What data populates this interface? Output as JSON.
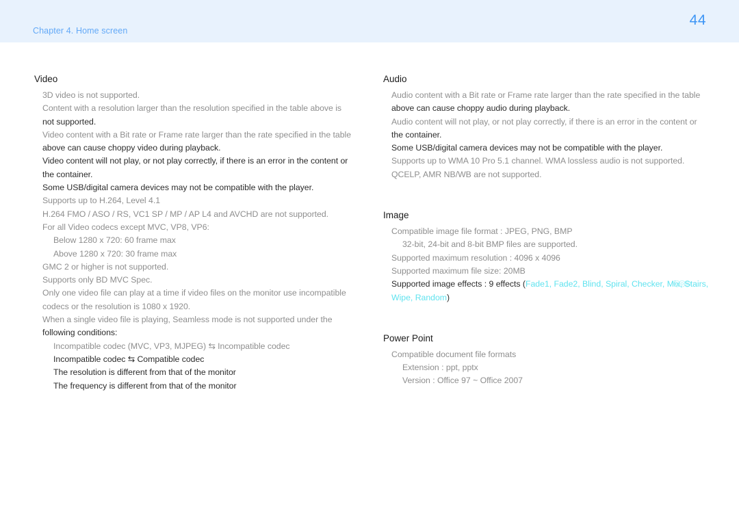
{
  "header": {
    "chapter_label": "Chapter 4. Home screen",
    "page_number": "44",
    "band_color": "#e8f2fd",
    "link_color": "#63a9f7"
  },
  "colors": {
    "accent_cyan": "#62e3ef",
    "body_gray": "#8e8e8e",
    "body_dark": "#2b2b2b"
  },
  "left_column": {
    "sections": [
      {
        "title": "Video",
        "lines": [
          {
            "text": "3D video is not supported.",
            "tone": "gray",
            "indent": 0
          },
          {
            "text": "Content with a resolution larger than the resolution specified in the table above is",
            "tone": "gray",
            "indent": 0
          },
          {
            "text": "not supported.",
            "tone": "dark",
            "indent": 0
          },
          {
            "text": "Video content with a Bit rate or Frame rate larger than the rate specified in the table",
            "tone": "gray",
            "indent": 0
          },
          {
            "text": "above can cause choppy video during playback.",
            "tone": "dark",
            "indent": 0
          },
          {
            "text": "Video content will not play, or not play correctly, if there is an error in the content or",
            "tone": "dark",
            "indent": 0
          },
          {
            "text": "the container.",
            "tone": "dark",
            "indent": 0
          },
          {
            "text": "Some USB/digital camera devices may not be compatible with the player.",
            "tone": "dark",
            "indent": 0
          },
          {
            "text": "Supports up to H.264, Level 4.1",
            "tone": "gray",
            "indent": 0
          },
          {
            "text": "H.264 FMO / ASO / RS, VC1 SP / MP / AP L4 and AVCHD are not supported.",
            "tone": "gray",
            "indent": 0
          },
          {
            "text": "For all Video codecs except MVC, VP8, VP6:",
            "tone": "gray",
            "indent": 0
          },
          {
            "text": "Below 1280 x 720: 60 frame max",
            "tone": "gray",
            "indent": 1
          },
          {
            "text": "Above 1280 x 720: 30 frame max",
            "tone": "gray",
            "indent": 1
          },
          {
            "text": "GMC 2 or higher is not supported.",
            "tone": "gray",
            "indent": 0
          },
          {
            "text": "Supports only BD MVC Spec.",
            "tone": "gray",
            "indent": 0
          },
          {
            "text": "Only one video file can play at a time if video files on the monitor use incompatible",
            "tone": "gray",
            "indent": 0
          },
          {
            "text": "codecs or the resolution is 1080 x 1920.",
            "tone": "gray",
            "indent": 0
          },
          {
            "text": "When a single video file is playing, Seamless mode is not supported under the",
            "tone": "gray",
            "indent": 0
          },
          {
            "text": "following conditions:",
            "tone": "dark",
            "indent": 0
          },
          {
            "text": "Incompatible codec (MVC, VP3, MJPEG) ⇆ Incompatible codec",
            "tone": "gray",
            "indent": 1
          },
          {
            "text": "Incompatible codec ⇆ Compatible codec",
            "tone": "dark",
            "indent": 1
          },
          {
            "text": "The resolution is different from that of the monitor",
            "tone": "dark",
            "indent": 1
          },
          {
            "text": "The frequency is different from that of the monitor",
            "tone": "dark",
            "indent": 1
          }
        ]
      }
    ]
  },
  "right_column": {
    "sections": [
      {
        "title": "Audio",
        "lines": [
          {
            "text": "Audio content with a Bit rate or Frame rate larger than the rate specified in the table",
            "tone": "gray",
            "indent": 0
          },
          {
            "text": "above can cause choppy audio during playback.",
            "tone": "dark",
            "indent": 0
          },
          {
            "text": "Audio content will not play, or not play correctly, if there is an error in the content or",
            "tone": "gray",
            "indent": 0
          },
          {
            "text": "the container.",
            "tone": "dark",
            "indent": 0
          },
          {
            "text": "Some USB/digital camera devices may not be compatible with the player.",
            "tone": "dark",
            "indent": 0
          },
          {
            "text": "Supports up to WMA 10 Pro 5.1 channel. WMA lossless audio is not supported.",
            "tone": "gray",
            "indent": 0
          },
          {
            "text": "QCELP, AMR NB/WB are not supported.",
            "tone": "gray",
            "indent": 0
          }
        ]
      },
      {
        "title": "Image",
        "lines": [
          {
            "text": "Compatible image file format : JPEG, PNG, BMP",
            "tone": "gray",
            "indent": 0
          },
          {
            "text": "32-bit, 24-bit and 8-bit BMP files are supported.",
            "tone": "gray",
            "indent": 1
          },
          {
            "text": "Supported maximum resolution : 4096 x 4096",
            "tone": "gray",
            "indent": 0
          },
          {
            "text": "Supported maximum file size: 20MB",
            "tone": "gray",
            "indent": 0
          }
        ],
        "effects_line": {
          "prefix": "Supported image effects : 9 effects (",
          "effects": [
            "Fade1",
            "Fade2",
            "Blind",
            "Spiral",
            "Checker",
            "Mix",
            "Stairs",
            "Wipe",
            "Random"
          ],
          "suffix": ")",
          "separator": ", "
        }
      },
      {
        "title": "Power Point",
        "lines": [
          {
            "text": "Compatible document file formats",
            "tone": "gray",
            "indent": 0
          },
          {
            "text": "Extension : ppt, pptx",
            "tone": "gray",
            "indent": 1
          },
          {
            "text": "Version : Office 97 ~ Office 2007",
            "tone": "gray",
            "indent": 1
          }
        ]
      }
    ]
  }
}
